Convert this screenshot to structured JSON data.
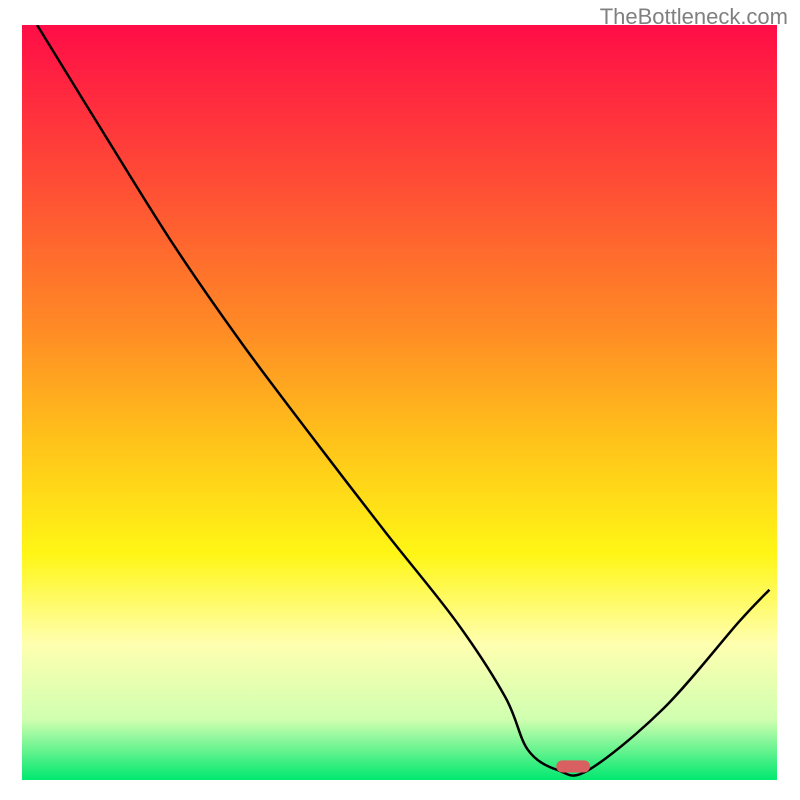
{
  "attribution": "TheBottleneck.com",
  "chart_data": {
    "type": "line",
    "title": "",
    "xlabel": "",
    "ylabel": "",
    "xlim": [
      0,
      100
    ],
    "ylim": [
      0,
      100
    ],
    "grid": false,
    "background_gradient": {
      "type": "vertical",
      "stops": [
        {
          "pos": 0,
          "color": "#ff0d47"
        },
        {
          "pos": 20,
          "color": "#ff4a36"
        },
        {
          "pos": 40,
          "color": "#ff8a25"
        },
        {
          "pos": 55,
          "color": "#ffc21a"
        },
        {
          "pos": 70,
          "color": "#fff615"
        },
        {
          "pos": 82,
          "color": "#ffffb0"
        },
        {
          "pos": 92,
          "color": "#d0ffb0"
        },
        {
          "pos": 100,
          "color": "#00e870"
        }
      ]
    },
    "series": [
      {
        "name": "bottleneck-curve",
        "x": [
          2,
          10,
          20,
          29,
          38,
          48,
          57.5,
          64,
          67,
          71,
          75,
          85,
          95,
          99
        ],
        "y": [
          100,
          87,
          71,
          58,
          46,
          33,
          21,
          11,
          4,
          1.3,
          1.3,
          9.5,
          21,
          25.2
        ],
        "color": "#000000",
        "line_width": 2.5
      }
    ],
    "marker": {
      "name": "optimal-point",
      "x": 73,
      "y": 1.8,
      "width": 4.5,
      "height": 1.6,
      "color": "#d96060",
      "shape": "rounded-rect"
    }
  }
}
